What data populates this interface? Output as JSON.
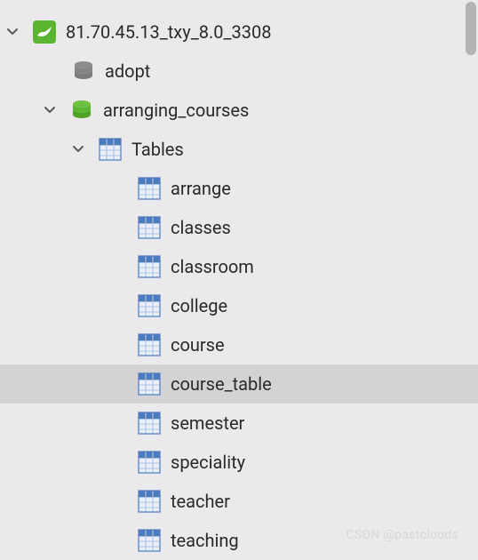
{
  "connection": {
    "name": "81.70.45.13_txy_8.0_3308"
  },
  "databases": {
    "adopt": {
      "name": "adopt"
    },
    "arranging_courses": {
      "name": "arranging_courses",
      "tables_folder": "Tables",
      "tables": [
        {
          "name": "arrange"
        },
        {
          "name": "classes"
        },
        {
          "name": "classroom"
        },
        {
          "name": "college"
        },
        {
          "name": "course"
        },
        {
          "name": "course_table",
          "selected": true
        },
        {
          "name": "semester"
        },
        {
          "name": "speciality"
        },
        {
          "name": "teacher"
        },
        {
          "name": "teaching"
        }
      ]
    }
  },
  "watermark": "CSDN @pastclouds",
  "colors": {
    "chevron": "#5a585a",
    "db_inactive": "#8c8c8c",
    "db_active": "#5cb531",
    "table_header": "#4d7bbd",
    "table_cell": "#dfeaf6",
    "connection_bg": "#5cb531",
    "connection_bird": "#ffffff"
  }
}
